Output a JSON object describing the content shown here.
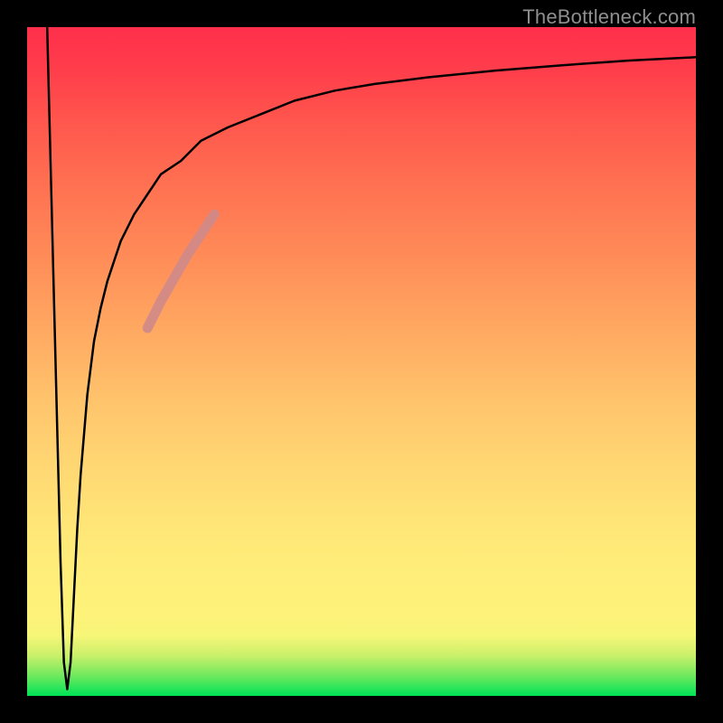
{
  "watermark": "TheBottleneck.com",
  "chart_data": {
    "type": "line",
    "title": "",
    "xlabel": "",
    "ylabel": "",
    "xlim": [
      0,
      100
    ],
    "ylim": [
      0,
      100
    ],
    "grid": false,
    "background_gradient": {
      "direction": "vertical",
      "stops": [
        {
          "pos": 0,
          "color": "#ff2f4b"
        },
        {
          "pos": 34,
          "color": "#ffa861"
        },
        {
          "pos": 66,
          "color": "#ffe878"
        },
        {
          "pos": 88,
          "color": "#fef27a"
        },
        {
          "pos": 94,
          "color": "#c9f06a"
        },
        {
          "pos": 100,
          "color": "#00e357"
        }
      ]
    },
    "series": [
      {
        "name": "bottleneck-curve",
        "color": "#000000",
        "x": [
          3,
          4,
          5,
          5.5,
          6,
          6.5,
          7,
          7.5,
          8,
          9,
          10,
          11,
          12,
          14,
          16,
          18,
          20,
          23,
          26,
          30,
          35,
          40,
          46,
          52,
          60,
          70,
          80,
          90,
          100
        ],
        "y": [
          100,
          60,
          20,
          5,
          1,
          5,
          15,
          25,
          33,
          45,
          53,
          58,
          62,
          68,
          72,
          75,
          78,
          80,
          83,
          85,
          87,
          89,
          90.5,
          91.5,
          92.5,
          93.5,
          94.3,
          95,
          95.5
        ]
      },
      {
        "name": "highlighted-segment",
        "color": "#cf8a8a",
        "x": [
          18,
          20,
          22,
          24,
          26,
          28
        ],
        "y": [
          55,
          59,
          62.5,
          66,
          69,
          72
        ]
      }
    ]
  }
}
